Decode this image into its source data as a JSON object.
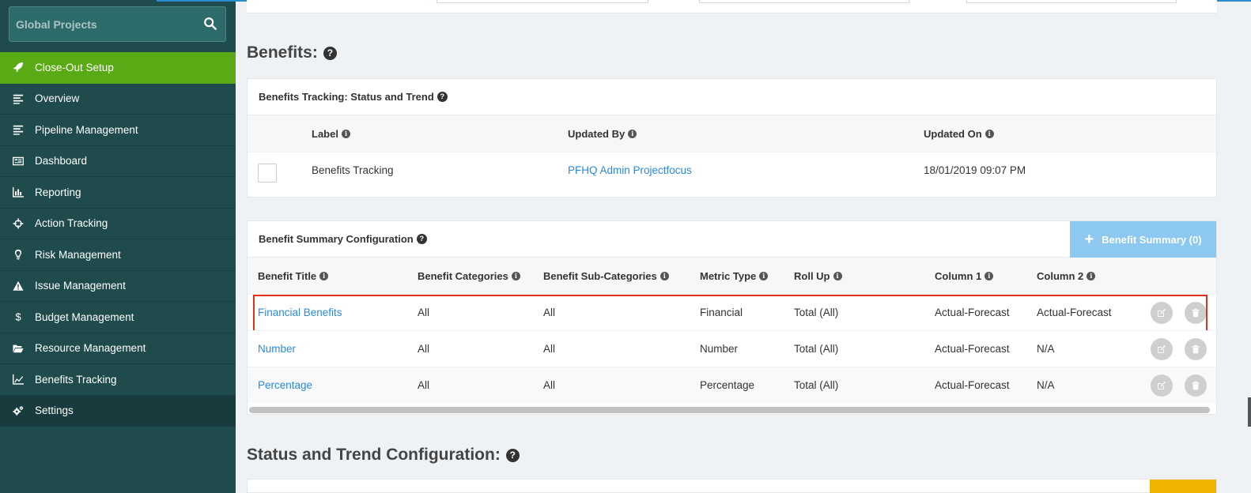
{
  "sidebar": {
    "search_label": "Global Projects",
    "items": [
      {
        "label": "Close-Out Setup",
        "icon": "rocket-icon",
        "active": true
      },
      {
        "label": "Overview",
        "icon": "align-left-icon"
      },
      {
        "label": "Pipeline Management",
        "icon": "align-left-icon"
      },
      {
        "label": "Dashboard",
        "icon": "dashboard-icon"
      },
      {
        "label": "Reporting",
        "icon": "bar-chart-icon"
      },
      {
        "label": "Action Tracking",
        "icon": "crosshairs-icon"
      },
      {
        "label": "Risk Management",
        "icon": "lightbulb-icon"
      },
      {
        "label": "Issue Management",
        "icon": "warning-icon"
      },
      {
        "label": "Budget Management",
        "icon": "dollar-icon"
      },
      {
        "label": "Resource Management",
        "icon": "folder-open-icon"
      },
      {
        "label": "Benefits Tracking",
        "icon": "line-chart-icon"
      },
      {
        "label": "Settings",
        "icon": "cogs-icon"
      }
    ]
  },
  "benefits_section": {
    "title": "Benefits:",
    "tracking_panel": {
      "title": "Benefits Tracking: Status and Trend",
      "columns": [
        "Label",
        "Updated By",
        "Updated On"
      ],
      "row": {
        "label": "Benefits Tracking",
        "updated_by": "PFHQ Admin Projectfocus",
        "updated_on": "18/01/2019 09:07 PM"
      }
    },
    "summary_panel": {
      "title": "Benefit Summary Configuration",
      "add_button_label": "Benefit Summary (0)",
      "columns": [
        "Benefit Title",
        "Benefit Categories",
        "Benefit Sub-Categories",
        "Metric Type",
        "Roll Up",
        "Column 1",
        "Column 2"
      ],
      "rows": [
        {
          "title": "Financial Benefits",
          "categories": "All",
          "sub_categories": "All",
          "metric": "Financial",
          "rollup": "Total (All)",
          "col1": "Actual-Forecast",
          "col2": "Actual-Forecast"
        },
        {
          "title": "Number",
          "categories": "All",
          "sub_categories": "All",
          "metric": "Number",
          "rollup": "Total (All)",
          "col1": "Actual-Forecast",
          "col2": "N/A"
        },
        {
          "title": "Percentage",
          "categories": "All",
          "sub_categories": "All",
          "metric": "Percentage",
          "rollup": "Total (All)",
          "col1": "Actual-Forecast",
          "col2": "N/A"
        }
      ]
    }
  },
  "status_section": {
    "title": "Status and Trend Configuration:"
  },
  "colors": {
    "sidebar_bg": "#1f4b4d",
    "active_green": "#5aaa16",
    "link_blue": "#2b8ad8",
    "add_button_blue": "#8dc8f0",
    "highlight_red": "#e0321c"
  }
}
